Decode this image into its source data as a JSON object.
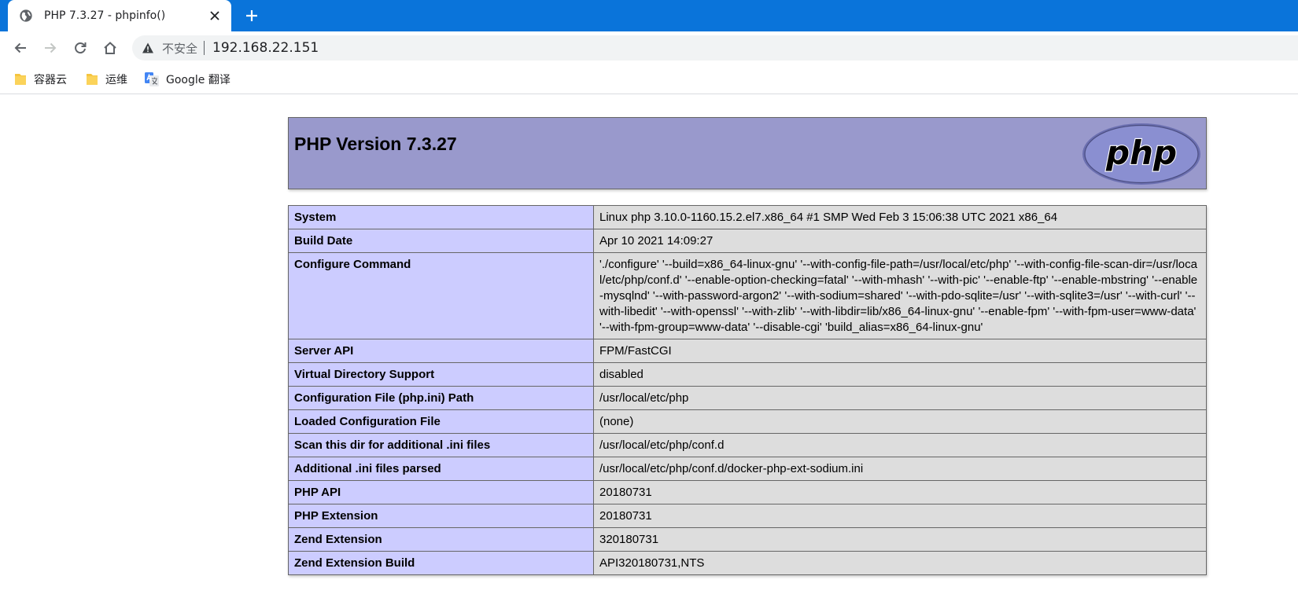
{
  "browser": {
    "tab": {
      "title": "PHP 7.3.27 - phpinfo()",
      "close_glyph": "✕"
    },
    "new_tab_glyph": "+",
    "omnibox": {
      "security_label": "不安全",
      "url": "192.168.22.151"
    },
    "bookmarks": [
      {
        "label": "容器云",
        "icon": "folder-icon"
      },
      {
        "label": "运维",
        "icon": "folder-icon"
      },
      {
        "label": "Google 翻译",
        "icon": "google-translate-icon"
      }
    ],
    "colors": {
      "tabstrip": "#0a74da",
      "omnibox_bg": "#f1f3f4"
    }
  },
  "phpinfo": {
    "header_title": "PHP Version 7.3.27",
    "logo_text": "php",
    "colors": {
      "header_bg": "#9999cc",
      "label_bg": "#ccccff",
      "value_bg": "#dddddd"
    },
    "rows": [
      {
        "label": "System",
        "value": "Linux php 3.10.0-1160.15.2.el7.x86_64 #1 SMP Wed Feb 3 15:06:38 UTC 2021 x86_64"
      },
      {
        "label": "Build Date",
        "value": "Apr 10 2021 14:09:27"
      },
      {
        "label": "Configure Command",
        "value": "'./configure' '--build=x86_64-linux-gnu' '--with-config-file-path=/usr/local/etc/php' '--with-config-file-scan-dir=/usr/local/etc/php/conf.d' '--enable-option-checking=fatal' '--with-mhash' '--with-pic' '--enable-ftp' '--enable-mbstring' '--enable-mysqlnd' '--with-password-argon2' '--with-sodium=shared' '--with-pdo-sqlite=/usr' '--with-sqlite3=/usr' '--with-curl' '--with-libedit' '--with-openssl' '--with-zlib' '--with-libdir=lib/x86_64-linux-gnu' '--enable-fpm' '--with-fpm-user=www-data' '--with-fpm-group=www-data' '--disable-cgi' 'build_alias=x86_64-linux-gnu'"
      },
      {
        "label": "Server API",
        "value": "FPM/FastCGI"
      },
      {
        "label": "Virtual Directory Support",
        "value": "disabled"
      },
      {
        "label": "Configuration File (php.ini) Path",
        "value": "/usr/local/etc/php"
      },
      {
        "label": "Loaded Configuration File",
        "value": "(none)"
      },
      {
        "label": "Scan this dir for additional .ini files",
        "value": "/usr/local/etc/php/conf.d"
      },
      {
        "label": "Additional .ini files parsed",
        "value": "/usr/local/etc/php/conf.d/docker-php-ext-sodium.ini"
      },
      {
        "label": "PHP API",
        "value": "20180731"
      },
      {
        "label": "PHP Extension",
        "value": "20180731"
      },
      {
        "label": "Zend Extension",
        "value": "320180731"
      },
      {
        "label": "Zend Extension Build",
        "value": "API320180731,NTS"
      }
    ]
  }
}
